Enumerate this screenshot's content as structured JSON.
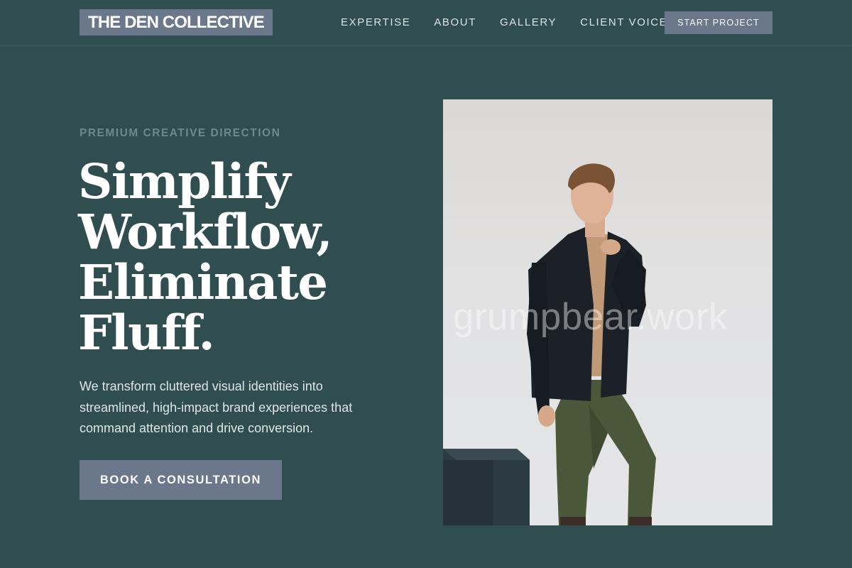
{
  "brand": {
    "logo_text": "THE DEN COLLECTIVE"
  },
  "nav": {
    "items": [
      {
        "label": "EXPERTISE"
      },
      {
        "label": "ABOUT"
      },
      {
        "label": "GALLERY"
      },
      {
        "label": "CLIENT VOICE"
      }
    ],
    "cta_label": "START PROJECT"
  },
  "hero": {
    "eyebrow": "PREMIUM CREATIVE DIRECTION",
    "headline_lines": [
      "Simplify",
      "Workflow,",
      "Eliminate",
      "Fluff."
    ],
    "lede": "We transform cluttered visual identities into streamlined, high-impact brand experiences that command attention and drive conversion.",
    "button_label": "BOOK A CONSULTATION",
    "image": {
      "subject": "man in dark blazer, tan shirt and olive trousers standing beside a dark cube",
      "watermark": "grumpbear.work"
    }
  },
  "colors": {
    "background": "#304d50",
    "accent_button": "#6b778a",
    "eyebrow": "#6d8a8c",
    "text": "#ffffff"
  }
}
